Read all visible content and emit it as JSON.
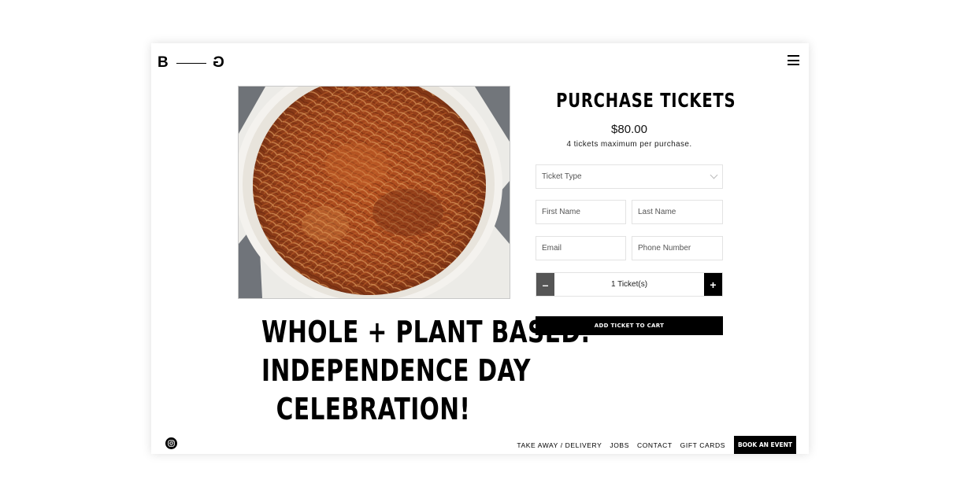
{
  "brand": {
    "logo_left": "B",
    "logo_right": "G"
  },
  "header": {
    "menu_icon": "hamburger-menu-icon"
  },
  "event": {
    "image_description_icon": "food-photo",
    "title_line1": "WHOLE + PLANT BASED:",
    "title_line2": "INDEPENDENCE DAY",
    "title_line3": "CELEBRATION!"
  },
  "purchase": {
    "heading": "PURCHASE TICKETS",
    "price": "$80.00",
    "max_note": "4 tickets maximum per purchase.",
    "ticket_type_placeholder": "Ticket Type",
    "first_name_placeholder": "First Name",
    "last_name_placeholder": "Last Name",
    "email_placeholder": "Email",
    "phone_placeholder": "Phone Number",
    "minus_label": "–",
    "plus_label": "+",
    "quantity_value": "1 Ticket(s)",
    "add_to_cart_label": "ADD TICKET TO CART"
  },
  "footer": {
    "social_icon": "instagram-icon",
    "links": [
      "TAKE AWAY / DELIVERY",
      "JOBS",
      "CONTACT",
      "GIFT CARDS"
    ],
    "book_label": "BOOK AN EVENT"
  },
  "colors": {
    "accent": "#000000",
    "stepper_minus": "#555555",
    "field_border": "#e3e3e3"
  }
}
